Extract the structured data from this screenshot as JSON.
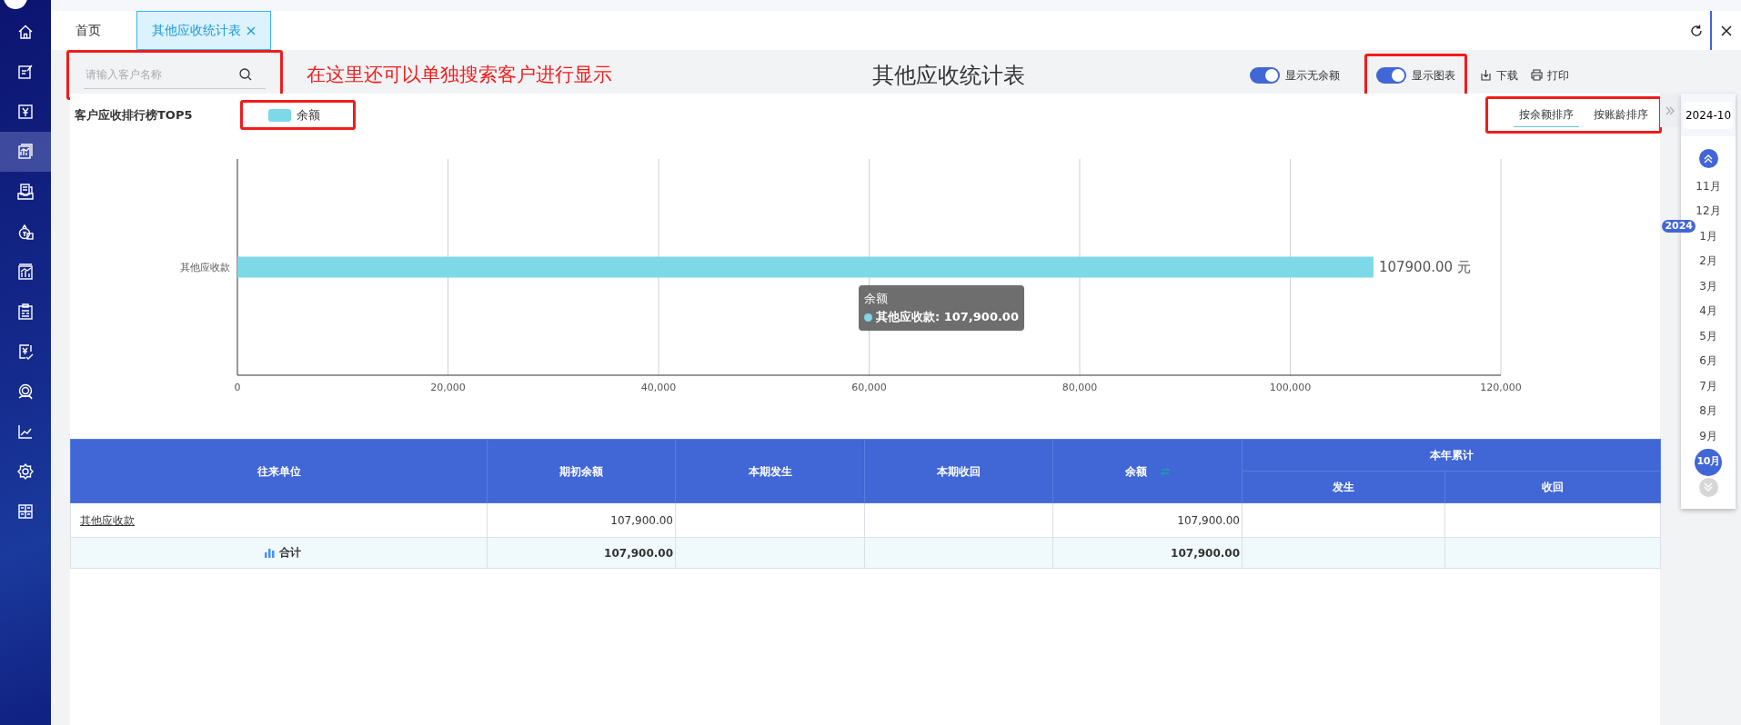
{
  "sidebar": {
    "items": [
      {
        "selected": false
      },
      {
        "selected": false
      },
      {
        "selected": false
      },
      {
        "selected": true
      },
      {
        "selected": false
      },
      {
        "selected": false
      },
      {
        "selected": false
      },
      {
        "selected": false
      },
      {
        "selected": false
      },
      {
        "selected": false
      },
      {
        "selected": false
      },
      {
        "selected": false
      },
      {
        "selected": false
      }
    ]
  },
  "tabs": [
    {
      "label": "首页",
      "selected": false,
      "closable": false
    },
    {
      "label": "其他应收统计表",
      "selected": true,
      "closable": true
    }
  ],
  "toolbar": {
    "search": {
      "placeholder": "请输入客户名称",
      "annotated": true
    },
    "annotation": "在这里还可以单独搜索客户进行显示",
    "title": "其他应收统计表",
    "toggles": [
      {
        "label": "显示无余额",
        "on": true,
        "annotated": false
      },
      {
        "label": "显示图表",
        "on": true,
        "annotated": true
      }
    ],
    "actions": [
      {
        "kind": "download",
        "label": "下载"
      },
      {
        "kind": "print",
        "label": "打印"
      }
    ]
  },
  "chart_panel": {
    "legend": {
      "annotated": true
    },
    "sort_tabs": {
      "annotated": true,
      "items": [
        {
          "label": "按余额排序",
          "selected": true
        },
        {
          "label": "按账龄排序",
          "selected": false
        }
      ]
    },
    "chart_data": {
      "type": "bar",
      "orientation": "horizontal",
      "title": "客户应收排行榜TOP5",
      "categories": [
        "其他应收款"
      ],
      "series": [
        {
          "name": "余额",
          "color": "#7dd8e8",
          "values": [
            107900
          ]
        }
      ],
      "xlim": [
        0,
        120000
      ],
      "xticks": [
        0,
        {
          "value": 20000,
          "label": "20,000"
        },
        {
          "value": 40000,
          "label": "40,000"
        },
        {
          "value": 60000,
          "label": "60,000"
        },
        {
          "value": 80000,
          "label": "80,000"
        },
        {
          "value": 100000,
          "label": "100,000"
        },
        {
          "value": 120000,
          "label": "120,000"
        }
      ],
      "grid": true,
      "value_labels": [
        "107900.00 元"
      ]
    },
    "tooltip": {
      "title": "余额",
      "text": "其他应收款: 107,900.00"
    }
  },
  "table": {
    "columns": [
      {
        "label": "往来单位",
        "sortable": false
      },
      {
        "label": "期初余额",
        "sortable": false
      },
      {
        "label": "本期发生",
        "sortable": false
      },
      {
        "label": "本期收回",
        "sortable": false
      },
      {
        "label": "余额",
        "sortable": true
      },
      {
        "label": "本年累计",
        "sortable": false,
        "children": [
          {
            "label": "发生"
          },
          {
            "label": "收回"
          }
        ]
      }
    ],
    "rows": [
      {
        "kind": "data",
        "cells": [
          "其他应收款",
          "107,900.00",
          null,
          null,
          "107,900.00",
          null,
          null
        ]
      },
      {
        "kind": "total",
        "cells": [
          "合计",
          "107,900.00",
          null,
          null,
          "107,900.00",
          null,
          null
        ]
      }
    ]
  },
  "calendar": {
    "value": "2024-10",
    "months": [
      {
        "label": "11月",
        "selected": false
      },
      {
        "label": "12月",
        "selected": false
      },
      {
        "label": "1月",
        "selected": false,
        "year_badge": "2024"
      },
      {
        "label": "2月",
        "selected": false
      },
      {
        "label": "3月",
        "selected": false
      },
      {
        "label": "4月",
        "selected": false
      },
      {
        "label": "5月",
        "selected": false
      },
      {
        "label": "6月",
        "selected": false
      },
      {
        "label": "7月",
        "selected": false
      },
      {
        "label": "8月",
        "selected": false
      },
      {
        "label": "9月",
        "selected": false
      },
      {
        "label": "10月",
        "selected": true
      }
    ]
  }
}
